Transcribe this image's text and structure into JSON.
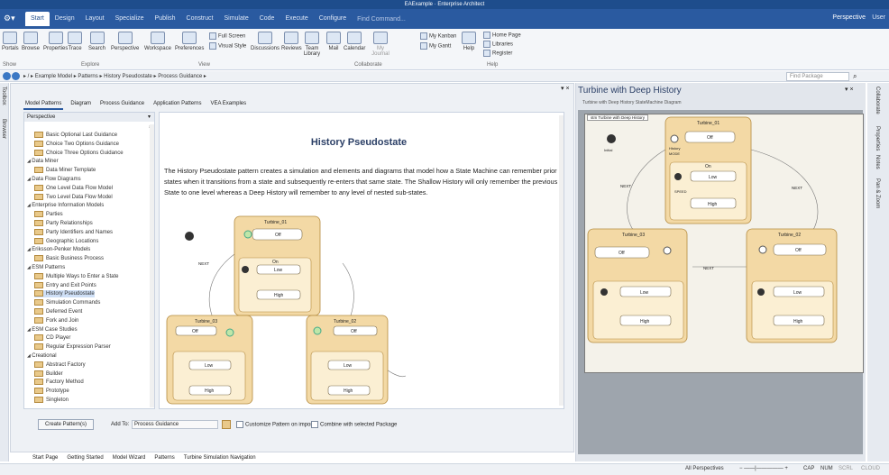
{
  "window": {
    "title": "EAExample · Enterprise Architect"
  },
  "menu": [
    "Start",
    "Design",
    "Layout",
    "Specialize",
    "Publish",
    "Construct",
    "Simulate",
    "Code",
    "Execute",
    "Configure"
  ],
  "find_command": "Find Command...",
  "perspective": "Perspective",
  "user": "User",
  "ribbon": {
    "buttons": [
      "Portals",
      "Browse",
      "Properties",
      "Trace",
      "Search",
      "Perspective",
      "Workspace",
      "Preferences"
    ],
    "view_small": [
      "Full Screen",
      "Visual Style"
    ],
    "collab_buttons": [
      "Discussions",
      "Reviews",
      "Team Library",
      "Mail",
      "Calendar",
      "My Journal"
    ],
    "collab_small": [
      "My Kanban",
      "My Gantt"
    ],
    "help_button": "Help",
    "help_small": [
      "Home Page",
      "Libraries",
      "Register"
    ],
    "groups": [
      "Show",
      "Explore",
      "View",
      "Collaborate",
      "Help"
    ]
  },
  "breadcrumb": [
    "Example Model",
    "Patterns",
    "History Pseudostate",
    "Process Guidance"
  ],
  "find_package": "Find Package",
  "left_tabs": [
    "Toolbox",
    "Browser"
  ],
  "main_tabs": [
    "Model Patterns",
    "Diagram",
    "Process Guidance",
    "Application Patterns",
    "VEA Examples"
  ],
  "tree": {
    "header": "Perspective",
    "items": [
      {
        "t": "Basic Optional Last Guidance",
        "k": "leaf"
      },
      {
        "t": "Choice Two Options Guidance",
        "k": "leaf"
      },
      {
        "t": "Choice Three Options Guidance",
        "k": "leaf"
      },
      {
        "t": "Data Miner",
        "k": "grp"
      },
      {
        "t": "Data Miner Template",
        "k": "leaf"
      },
      {
        "t": "Data Flow Diagrams",
        "k": "grp"
      },
      {
        "t": "One Level Data Flow Model",
        "k": "leaf"
      },
      {
        "t": "Two Level Data Flow Model",
        "k": "leaf"
      },
      {
        "t": "Enterprise Information Models",
        "k": "grp"
      },
      {
        "t": "Parties",
        "k": "leaf"
      },
      {
        "t": "Party Relationships",
        "k": "leaf"
      },
      {
        "t": "Party Identifiers and Names",
        "k": "leaf"
      },
      {
        "t": "Geographic Locations",
        "k": "leaf"
      },
      {
        "t": "Eriksson-Penker Models",
        "k": "grp"
      },
      {
        "t": "Basic Business Process",
        "k": "leaf"
      },
      {
        "t": "ESM Patterns",
        "k": "grp"
      },
      {
        "t": "Multiple Ways to Enter a State",
        "k": "leaf"
      },
      {
        "t": "Entry and Exit Points",
        "k": "leaf"
      },
      {
        "t": "History Pseudostate",
        "k": "leaf",
        "sel": true
      },
      {
        "t": "Simulation Commands",
        "k": "leaf"
      },
      {
        "t": "Deferred Event",
        "k": "leaf"
      },
      {
        "t": "Fork and Join",
        "k": "leaf"
      },
      {
        "t": "ESM Case Studies",
        "k": "grp"
      },
      {
        "t": "CD Player",
        "k": "leaf"
      },
      {
        "t": "Regular Expression Parser",
        "k": "leaf"
      },
      {
        "t": "Creational",
        "k": "grp"
      },
      {
        "t": "Abstract Factory",
        "k": "leaf"
      },
      {
        "t": "Builder",
        "k": "leaf"
      },
      {
        "t": "Factory Method",
        "k": "leaf"
      },
      {
        "t": "Prototype",
        "k": "leaf"
      },
      {
        "t": "Singleton",
        "k": "leaf"
      }
    ]
  },
  "pattern": {
    "title": "History Pseudostate",
    "description": "The History Pseudostate pattern creates a simulation and elements and diagrams that model how a State Machine can remember prior states when it transitions from a state and subsequently re-enters that same state. The Shallow History will only remember the previous State to one level whereas a Deep History will remember to any level of nested sub-states."
  },
  "diagram": {
    "turbines": [
      "Turbine_01",
      "Turbine_02",
      "Turbine_03"
    ],
    "off": "Off",
    "on": "On",
    "low": "Low",
    "high": "High",
    "mode": "MODE",
    "speed": "SPEED",
    "next": "NEXT",
    "initial": "Initial",
    "history": "History"
  },
  "bottom": {
    "create": "Create Pattern(s)",
    "add_to": "Add To:",
    "add_to_value": "Process Guidance",
    "customize": "Customize Pattern on import",
    "combine": "Combine with selected Package"
  },
  "doc_tabs": [
    "Start Page",
    "Getting Started",
    "Model Wizard",
    "Patterns",
    "Turbine Simulation Navigation"
  ],
  "right": {
    "title": "Turbine with Deep History",
    "subtitle": "Turbine with Deep History   StateMachine Diagram",
    "frame_label": "stm Turbine with Deep History"
  },
  "right_tabs": [
    "Collaborate",
    "Properties",
    "Notes",
    "Pan & Zoom"
  ],
  "status": {
    "perspective": "All Perspectives",
    "caps": "CAP",
    "num": "NUM",
    "scrl": "SCRL",
    "cloud": "CLOUD"
  }
}
